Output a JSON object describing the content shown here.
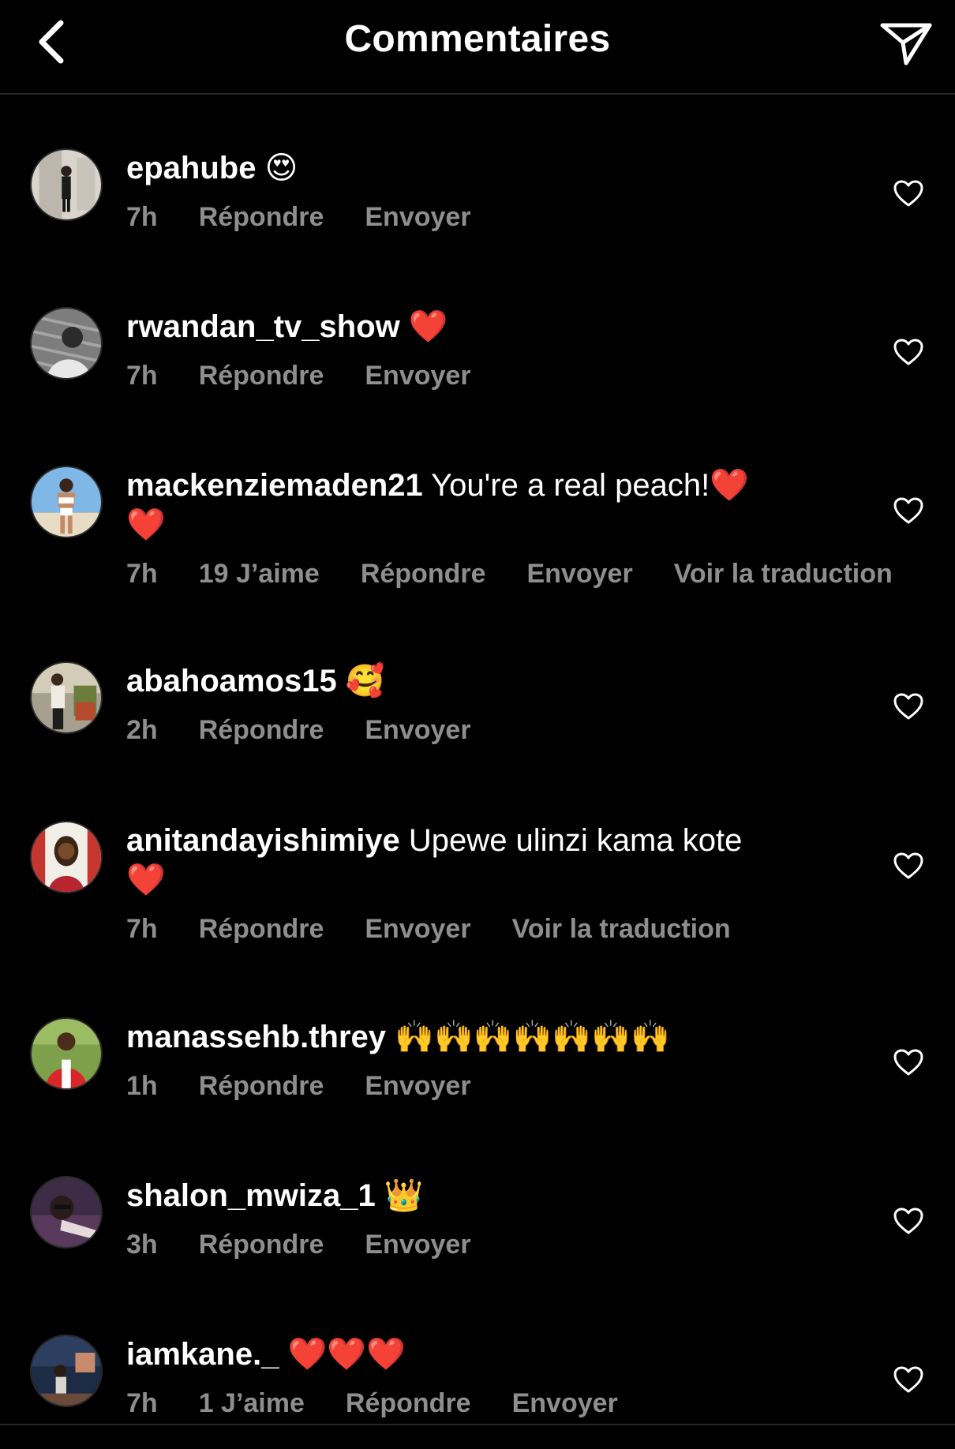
{
  "header": {
    "title": "Commentaires",
    "back_icon": "chevron-left-icon",
    "send_icon": "paper-plane-icon"
  },
  "comments": [
    {
      "username": "epahube",
      "text": "",
      "emoji": "😍",
      "time": "7h",
      "likes": "",
      "reply": "Répondre",
      "send": "Envoyer",
      "translate": ""
    },
    {
      "username": "rwandan_tv_show",
      "text": "",
      "emoji": "❤️",
      "time": "7h",
      "likes": "",
      "reply": "Répondre",
      "send": "Envoyer",
      "translate": ""
    },
    {
      "username": "mackenziemaden21",
      "text": "You're a real peach!",
      "emoji": "❤️",
      "emoji_line2": "❤️",
      "time": "7h",
      "likes": "19 J’aime",
      "reply": "Répondre",
      "send": "Envoyer",
      "translate": "Voir la traduction"
    },
    {
      "username": "abahoamos15",
      "text": "",
      "emoji": "🥰",
      "time": "2h",
      "likes": "",
      "reply": "Répondre",
      "send": "Envoyer",
      "translate": ""
    },
    {
      "username": "anitandayishimiye",
      "text": "Upewe ulinzi kama kote",
      "emoji": "",
      "emoji_line2": "❤️",
      "time": "7h",
      "likes": "",
      "reply": "Répondre",
      "send": "Envoyer",
      "translate": "Voir la traduction"
    },
    {
      "username": "manassehb.threy",
      "text": "",
      "emoji": "🙌🙌🙌🙌🙌🙌🙌",
      "time": "1h",
      "likes": "",
      "reply": "Répondre",
      "send": "Envoyer",
      "translate": ""
    },
    {
      "username": "shalon_mwiza_1",
      "text": "",
      "emoji": "👑",
      "time": "3h",
      "likes": "",
      "reply": "Répondre",
      "send": "Envoyer",
      "translate": ""
    },
    {
      "username": "iamkane._",
      "text": "",
      "emoji": "❤️❤️❤️",
      "time": "7h",
      "likes": "1 J’aime",
      "reply": "Répondre",
      "send": "Envoyer",
      "translate": ""
    }
  ],
  "colors": {
    "background": "#000000",
    "text": "#ffffff",
    "secondary": "#8e8e8e",
    "divider": "#262626",
    "heart": "#e8232f"
  },
  "icons": {
    "like": "heart-outline-icon"
  }
}
